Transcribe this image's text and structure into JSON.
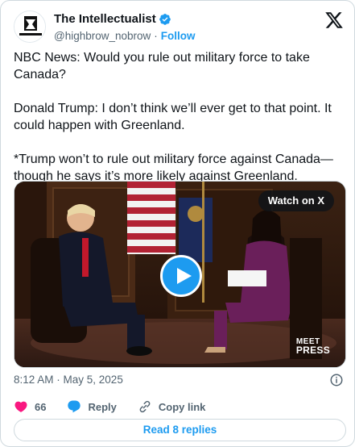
{
  "author": {
    "display_name": "The Intellectualist",
    "handle": "@highbrow_nobrow",
    "separator": "·",
    "follow_label": "Follow",
    "avatar_text": "The Intellectualist"
  },
  "tweet": {
    "paragraphs": [
      "NBC News: Would you rule out military force to take Canada?",
      "Donald Trump: I don’t think we’ll ever get to that point. It could happen with Greenland.",
      "*Trump won’t to rule out military force against Canada—though he says it’s more likely against Greenland."
    ]
  },
  "media": {
    "watch_label": "Watch on X",
    "logo_line1": "MEET",
    "logo_small": "THE",
    "logo_line2": "PRESS"
  },
  "meta": {
    "timestamp": "8:12 AM · May 5, 2025"
  },
  "actions": {
    "like_count": "66",
    "reply_label": "Reply",
    "copy_label": "Copy link"
  },
  "footer": {
    "read_replies": "Read 8 replies"
  },
  "colors": {
    "accent": "#1d9bf0",
    "like": "#f91880",
    "text": "#0f1419",
    "muted": "#536471"
  }
}
